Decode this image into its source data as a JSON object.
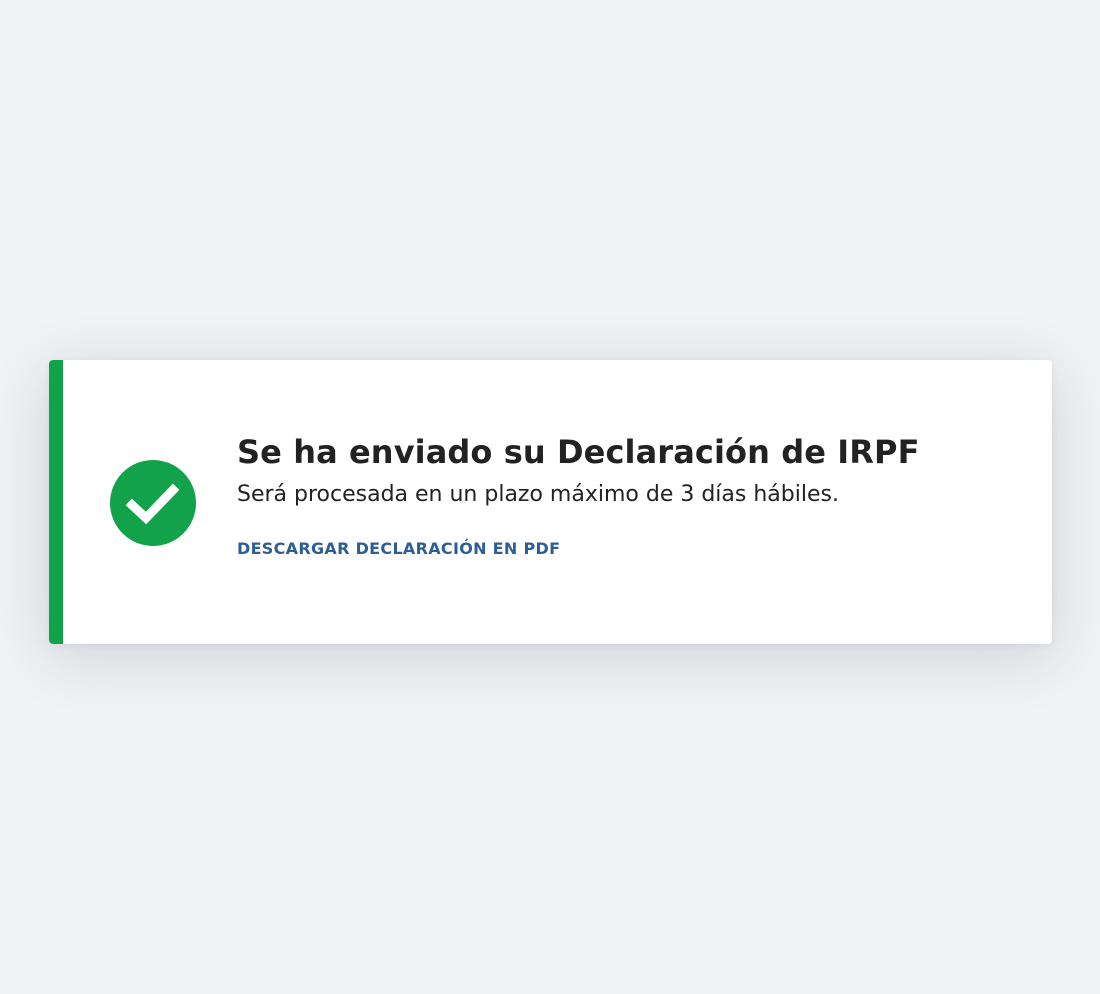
{
  "notice": {
    "type": "success",
    "title": "Se ha enviado su Declaración de IRPF",
    "message": "Será procesada en un plazo máximo de 3 días hábiles.",
    "action_label": "DESCARGAR DECLARACIÓN EN PDF",
    "icon": "check-circle-icon",
    "colors": {
      "accent": "#12a24a",
      "link": "#2d5e94",
      "text": "#222222",
      "background": "#f0f2f5",
      "card": "#ffffff"
    }
  }
}
